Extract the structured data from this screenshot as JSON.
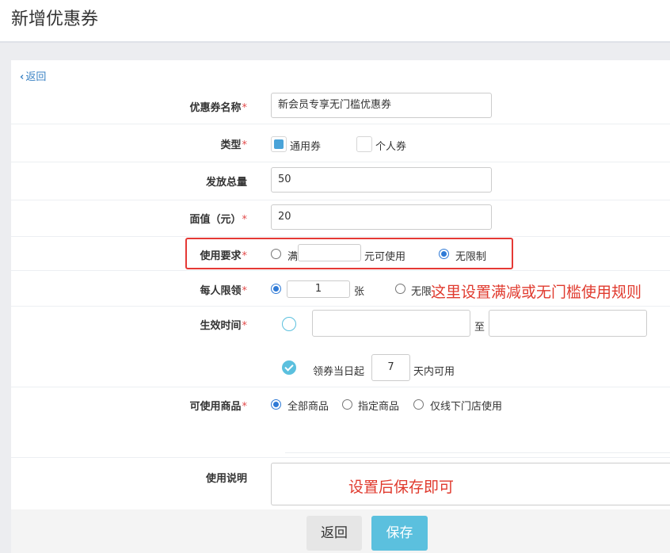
{
  "page": {
    "title": "新增优惠券"
  },
  "back_link": {
    "label": "返回"
  },
  "form": {
    "name": {
      "label": "优惠券名称",
      "value": "新会员专享无门槛优惠券"
    },
    "type": {
      "label": "类型",
      "options": [
        "通用券",
        "个人券"
      ],
      "selected": "通用券"
    },
    "total": {
      "label": "发放总量",
      "value": "50"
    },
    "face_value": {
      "label": "面值（元）",
      "value": "20"
    },
    "requirement": {
      "label": "使用要求",
      "option_full_prefix": "满",
      "option_full_value": "",
      "option_full_suffix": "元可使用",
      "option_unlimited": "无限制",
      "selected": "无限制"
    },
    "per_person": {
      "label": "每人限领",
      "value": "1",
      "unit": "张",
      "option_unlimited": "无限",
      "selected": "limited"
    },
    "effective_time": {
      "label": "生效时间",
      "start": "",
      "to_label": "至",
      "end": "",
      "relative_prefix": "领券当日起",
      "relative_days": "7",
      "relative_suffix": "天内可用"
    },
    "applicable_goods": {
      "label": "可使用商品",
      "options": [
        "全部商品",
        "指定商品",
        "仅线下门店使用"
      ],
      "selected": "全部商品"
    },
    "description": {
      "label": "使用说明",
      "value": ""
    }
  },
  "annotations": {
    "rule_note": "这里设置满减或无门槛使用规则",
    "save_note": "设置后保存即可"
  },
  "buttons": {
    "back": "返回",
    "save": "保存"
  },
  "colors": {
    "accent": "#5bc0de",
    "radio": "#2f7ad6",
    "annotation": "#e03a2e",
    "required": "#e24a4a"
  }
}
